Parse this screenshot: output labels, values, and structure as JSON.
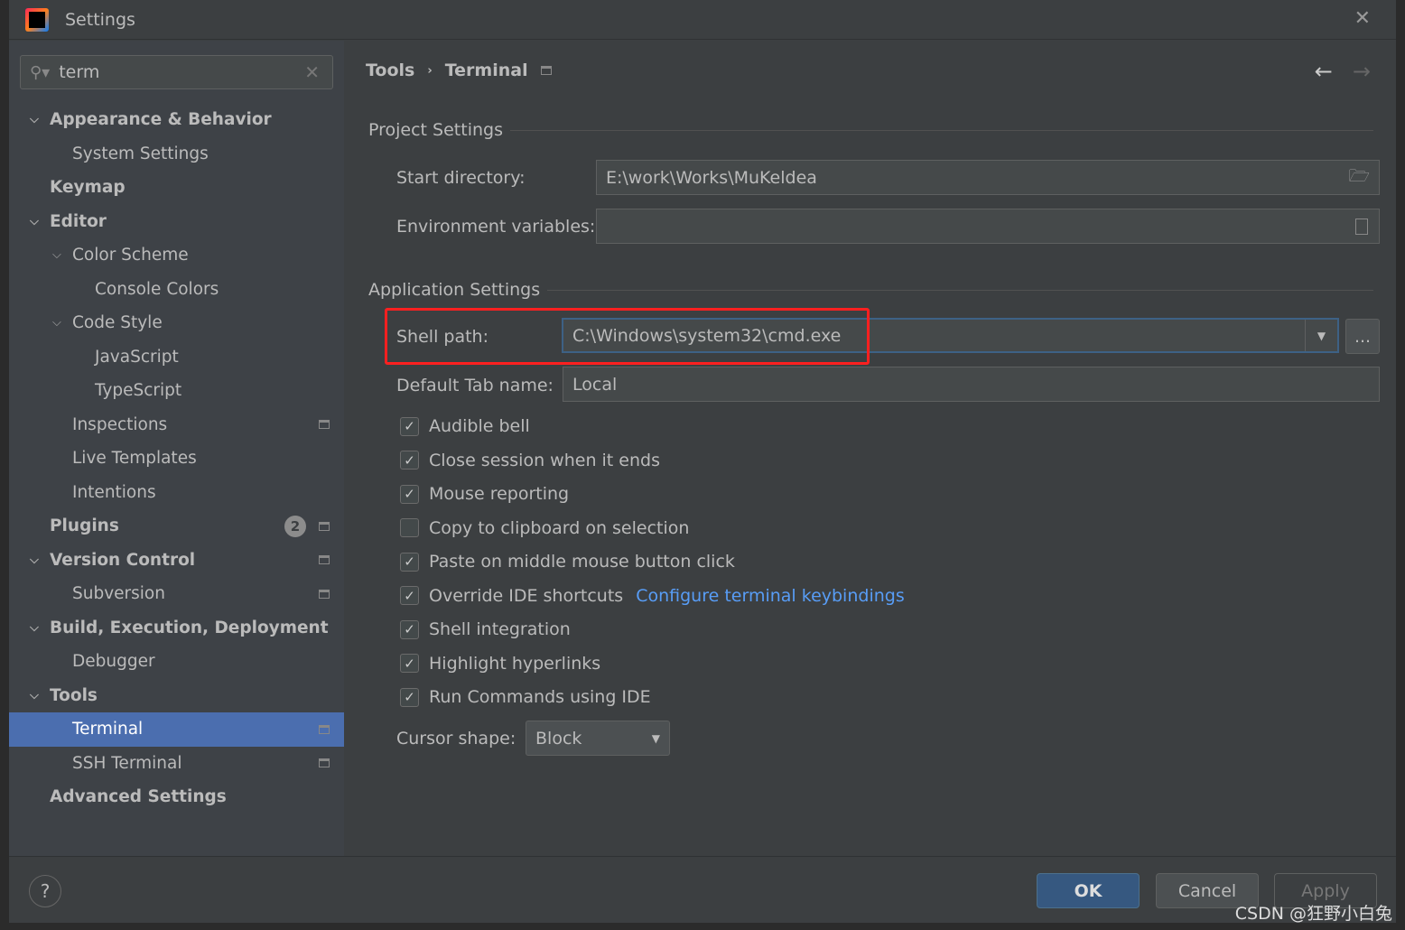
{
  "window": {
    "title": "Settings"
  },
  "search": {
    "value": "term"
  },
  "tree": [
    {
      "label": "Appearance & Behavior",
      "level": 0,
      "bold": true,
      "expanded": true
    },
    {
      "label": "System Settings",
      "level": 1
    },
    {
      "label": "Keymap",
      "level": 0,
      "bold": true
    },
    {
      "label": "Editor",
      "level": 0,
      "bold": true,
      "expanded": true
    },
    {
      "label": "Color Scheme",
      "level": 1,
      "expanded": true
    },
    {
      "label": "Console Colors",
      "level": 2
    },
    {
      "label": "Code Style",
      "level": 1,
      "expanded": true
    },
    {
      "label": "JavaScript",
      "level": 2
    },
    {
      "label": "TypeScript",
      "level": 2
    },
    {
      "label": "Inspections",
      "level": 1,
      "project": true
    },
    {
      "label": "Live Templates",
      "level": 1
    },
    {
      "label": "Intentions",
      "level": 1
    },
    {
      "label": "Plugins",
      "level": 0,
      "bold": true,
      "badge": "2",
      "project": true
    },
    {
      "label": "Version Control",
      "level": 0,
      "bold": true,
      "expanded": true,
      "project": true
    },
    {
      "label": "Subversion",
      "level": 1,
      "project": true
    },
    {
      "label": "Build, Execution, Deployment",
      "level": 0,
      "bold": true,
      "expanded": true
    },
    {
      "label": "Debugger",
      "level": 1
    },
    {
      "label": "Tools",
      "level": 0,
      "bold": true,
      "expanded": true
    },
    {
      "label": "Terminal",
      "level": 1,
      "selected": true,
      "project": true
    },
    {
      "label": "SSH Terminal",
      "level": 1,
      "project": true
    },
    {
      "label": "Advanced Settings",
      "level": 0,
      "bold": true
    }
  ],
  "breadcrumb": {
    "parent": "Tools",
    "current": "Terminal"
  },
  "project": {
    "section": "Project Settings",
    "start_dir_label": "Start directory:",
    "start_dir": "E:\\work\\Works\\MuKeldea",
    "env_label": "Environment variables:",
    "env": ""
  },
  "app": {
    "section": "Application Settings",
    "shell_label": "Shell path:",
    "shell": "C:\\Windows\\system32\\cmd.exe",
    "browse": "...",
    "tab_label": "Default Tab name:",
    "tab": "Local",
    "checkboxes": [
      {
        "label": "Audible bell",
        "checked": true
      },
      {
        "label": "Close session when it ends",
        "checked": true
      },
      {
        "label": "Mouse reporting",
        "checked": true
      },
      {
        "label": "Copy to clipboard on selection",
        "checked": false
      },
      {
        "label": "Paste on middle mouse button click",
        "checked": true
      },
      {
        "label": "Override IDE shortcuts",
        "checked": true,
        "link": "Configure terminal keybindings"
      },
      {
        "label": "Shell integration",
        "checked": true
      },
      {
        "label": "Highlight hyperlinks",
        "checked": true
      },
      {
        "label": "Run Commands using IDE",
        "checked": true
      }
    ],
    "cursor_label": "Cursor shape:",
    "cursor": "Block"
  },
  "footer": {
    "help": "?",
    "ok": "OK",
    "cancel": "Cancel",
    "apply": "Apply"
  },
  "watermark": "CSDN @狂野小白兔",
  "colors": {
    "selection": "#4b6eaf",
    "link": "#589df6",
    "highlight": "#ff2020"
  }
}
